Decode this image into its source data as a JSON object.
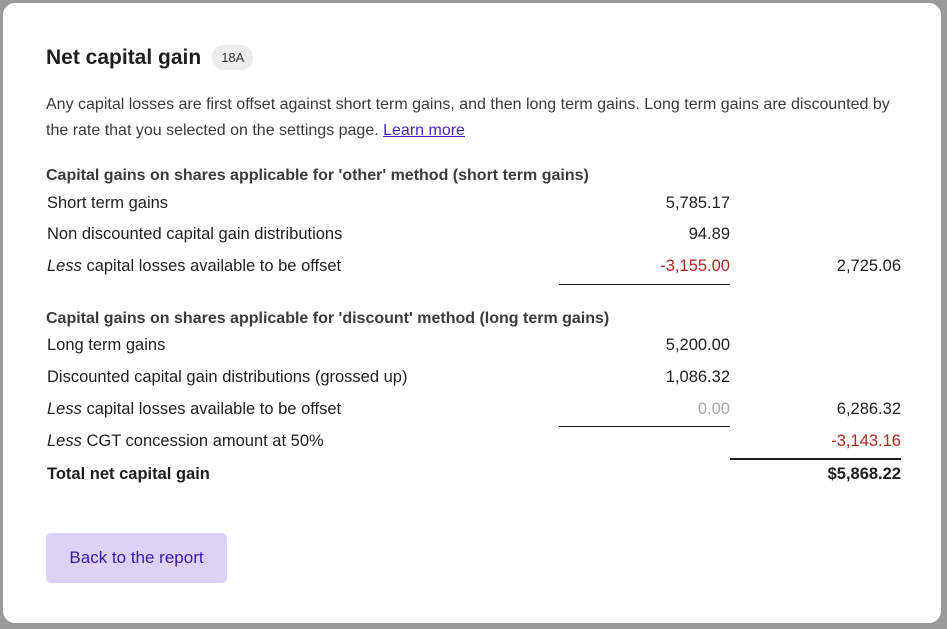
{
  "title": "Net capital gain",
  "badge": "18A",
  "description": "Any capital losses are first offset against short term gains, and then long term gains. Long term gains are discounted by the rate that you selected on the settings page.",
  "learn_more": "Learn more",
  "short_section": {
    "heading": "Capital gains on shares applicable for 'other' method (short term gains)",
    "rows": [
      {
        "label": "Short term gains",
        "col1": "5,785.17",
        "col2": ""
      },
      {
        "label": "Non discounted capital gain distributions",
        "col1": "94.89",
        "col2": ""
      },
      {
        "label_em": "Less",
        "label_rest": " capital losses available to be offset",
        "col1": "-3,155.00",
        "col2": "2,725.06"
      }
    ]
  },
  "long_section": {
    "heading": "Capital gains on shares applicable for 'discount' method (long term gains)",
    "rows": [
      {
        "label": "Long term gains",
        "col1": "5,200.00",
        "col2": ""
      },
      {
        "label": "Discounted capital gain distributions (grossed up)",
        "col1": "1,086.32",
        "col2": ""
      },
      {
        "label_em": "Less",
        "label_rest": " capital losses available to be offset",
        "col1": "0.00",
        "col2": "6,286.32"
      },
      {
        "label_em": "Less",
        "label_rest": " CGT concession amount at 50%",
        "col1": "",
        "col2": "-3,143.16"
      }
    ]
  },
  "total": {
    "label": "Total net capital gain",
    "value": "$5,868.22"
  },
  "back_button": "Back to the report",
  "colors": {
    "negative": "#b3261e",
    "link": "#4a1fc0",
    "button_bg": "#dcd2f7",
    "button_text": "#3c18a8",
    "muted": "#a6a6ad"
  }
}
